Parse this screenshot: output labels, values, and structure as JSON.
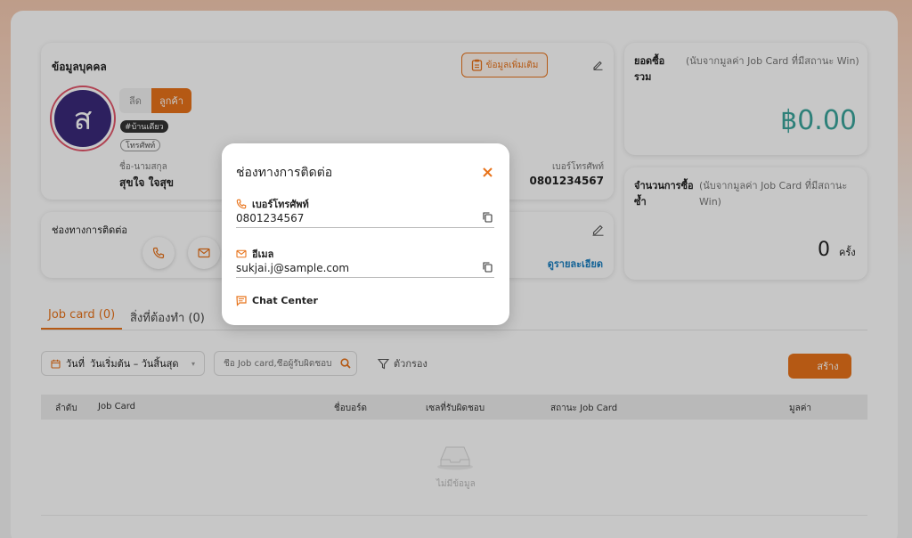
{
  "profile": {
    "title": "ข้อมูลบุคคล",
    "more_info_label": "ข้อมูลเพิ่มเติม",
    "toggle": {
      "lead_label": "ลีด",
      "customer_label": "ลูกค้า"
    },
    "avatar_initial": "ส",
    "chips": [
      "#บ้านเดียว",
      "โทรศัพท์"
    ],
    "name_label": "ชื่อ-นามสกุล",
    "name_value": "สุขใจ ใจสุข",
    "phone_label": "เบอร์โทรศัพท์",
    "phone_value": "0801234567"
  },
  "contact_card": {
    "title": "ช่องทางการติดต่อ",
    "details_link": "ดูรายละเอียด"
  },
  "summary": {
    "total_label": "ยอดซื้อรวม",
    "total_note": "(นับจากมูลค่า Job Card ที่มีสถานะ Win)",
    "total_value": "฿0.00",
    "repeat_label": "จำนวนการซื้อซ้ำ",
    "repeat_note": "(นับจากมูลค่า Job Card ที่มีสถานะ Win)",
    "repeat_value": "0",
    "repeat_unit": "ครั้ง"
  },
  "tabs": [
    {
      "label": "Job card (0)"
    },
    {
      "label": "สิ่งที่ต้องทำ (0)"
    }
  ],
  "filters": {
    "date_label": "วันที่",
    "date_value": "วันเริ่มต้น – วันสิ้นสุด",
    "search_placeholder": "ชื่อ Job card,ชื่อผู้รับผิดชอบ",
    "filter_label": "ตัวกรอง",
    "create_label": "สร้าง"
  },
  "table": {
    "columns": [
      "ลำดับ",
      "Job Card",
      "ชื่อบอร์ด",
      "เซลที่รับผิดชอบ",
      "สถานะ Job Card",
      "มูลค่า"
    ],
    "empty_text": "ไม่มีข้อมูล"
  },
  "modal": {
    "title": "ช่องทางการติดต่อ",
    "phone_label": "เบอร์โทรศัพท์",
    "phone_value": "0801234567",
    "email_label": "อีเมล",
    "email_value": "sukjai.j@sample.com",
    "chat_label": "Chat Center"
  },
  "colors": {
    "accent": "#e8731a",
    "teal": "#3aa59b",
    "avatar": "#3a2a7a"
  }
}
